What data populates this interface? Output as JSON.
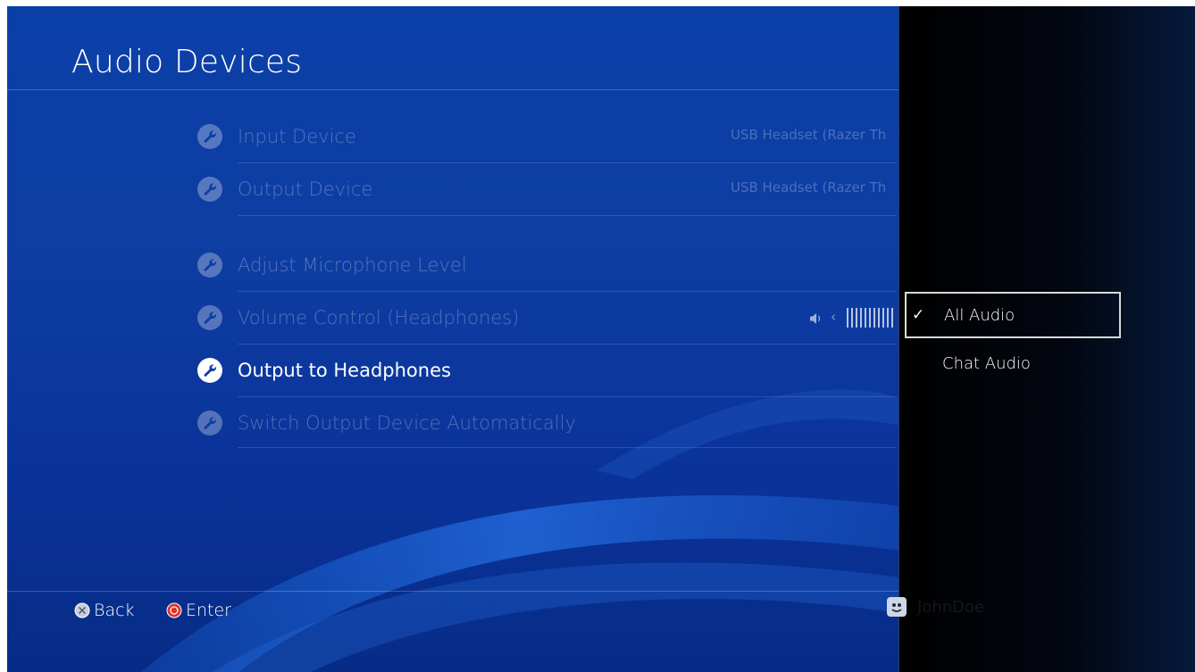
{
  "header": {
    "title": "Audio Devices"
  },
  "settings": {
    "items": [
      {
        "label": "Input Device",
        "value": "USB Headset (Razer Th"
      },
      {
        "label": "Output Device",
        "value": "USB Headset (Razer Th"
      },
      {
        "label": "Adjust Microphone Level"
      },
      {
        "label": "Volume Control (Headphones)"
      },
      {
        "label": "Output to Headphones"
      },
      {
        "label": "Switch Output Device Automatically"
      }
    ]
  },
  "footer": {
    "back_label": "Back",
    "enter_label": "Enter",
    "username": "JohnDoe"
  },
  "dropdown": {
    "check_glyph": "✓",
    "options": [
      {
        "label": "All Audio",
        "selected": true
      },
      {
        "label": "Chat Audio",
        "selected": false
      }
    ]
  },
  "colors": {
    "background": "#0b3fa8",
    "panel": "#000000",
    "back_button": "#c8cdd8",
    "enter_button": "#e0322f"
  },
  "icons": {
    "setting": "wrench-icon",
    "back": "cross-button-icon",
    "enter": "circle-button-icon",
    "volume": "speaker-icon",
    "user": "avatar-icon"
  }
}
